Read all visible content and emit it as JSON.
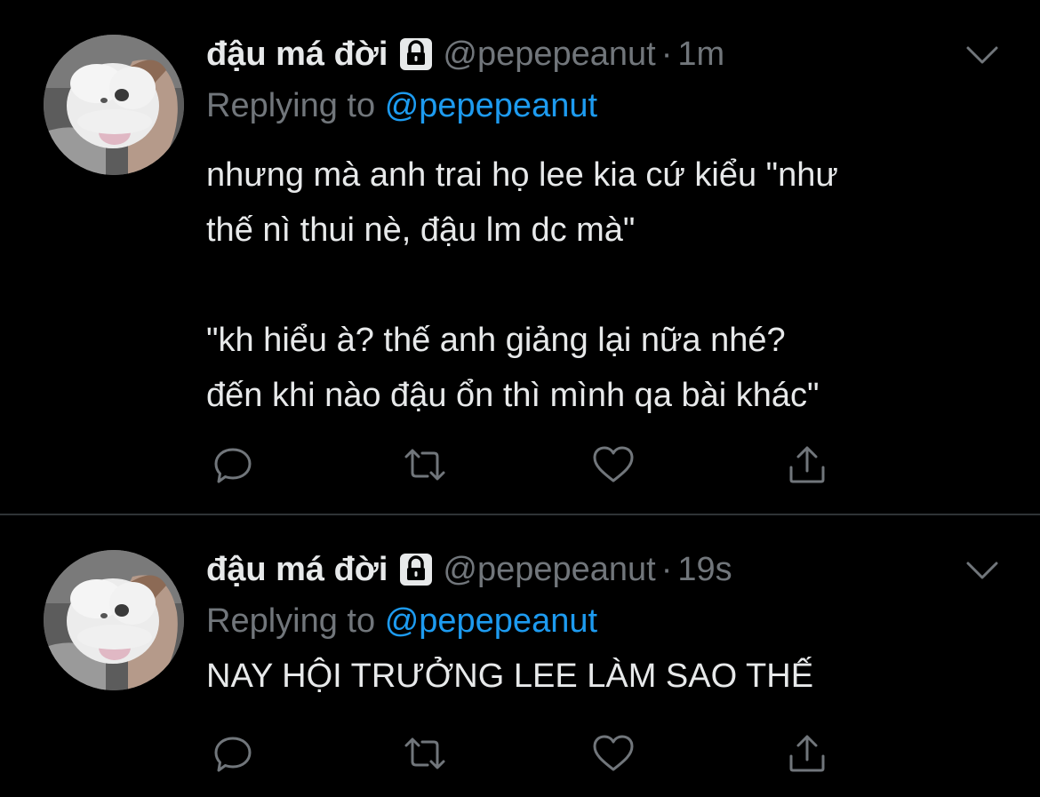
{
  "colors": {
    "background": "#000000",
    "text_primary": "#e7e9ea",
    "text_secondary": "#71767b",
    "accent": "#1d9bf0",
    "divider": "#2f3336"
  },
  "tweets": [
    {
      "display_name": "đậu má đời",
      "protected_icon": "lock-icon",
      "handle": "@pepepeanut",
      "separator": "·",
      "time": "1m",
      "replying_prefix": "Replying to",
      "replying_mention": "@pepepeanut",
      "text": "nhưng mà anh trai họ lee kia cứ kiểu \"như\nthế nì thui nè, đậu lm dc mà\"\n\n\"kh hiểu à? thế anh giảng lại nữa nhé?\nđến khi nào đậu ổn thì mình qa bài khác\"",
      "actions": [
        "reply-icon",
        "retweet-icon",
        "like-icon",
        "share-icon"
      ]
    },
    {
      "display_name": "đậu má đời",
      "protected_icon": "lock-icon",
      "handle": "@pepepeanut",
      "separator": "·",
      "time": "19s",
      "replying_prefix": "Replying to",
      "replying_mention": "@pepepeanut",
      "text": "NAY HỘI TRƯỞNG LEE LÀM SAO THẾ",
      "actions": [
        "reply-icon",
        "retweet-icon",
        "like-icon",
        "share-icon"
      ]
    }
  ]
}
